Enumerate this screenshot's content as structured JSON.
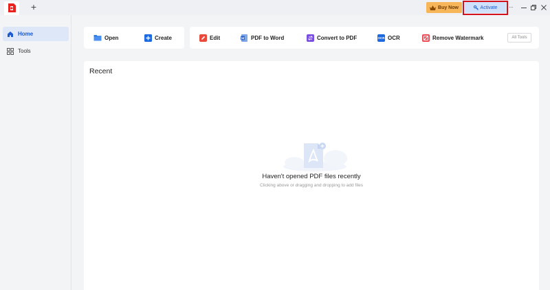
{
  "titlebar": {
    "new_tab": "+",
    "buy_now": "Buy Now",
    "activate": "Activate",
    "more": "···",
    "icons": [
      "app-logo",
      "crown-icon",
      "key-icon",
      "minimize-icon",
      "restore-icon",
      "close-icon"
    ]
  },
  "sidebar": {
    "items": [
      {
        "label": "Home",
        "icon": "home-icon",
        "active": true
      },
      {
        "label": "Tools",
        "icon": "grid-icon",
        "active": false
      }
    ]
  },
  "toolbar": {
    "open": "Open",
    "create": "Create",
    "edit": "Edit",
    "pdf_to_word": "PDF to Word",
    "convert_to_pdf": "Convert to PDF",
    "ocr": "OCR",
    "ocr_badge": "OCR",
    "remove_watermark": "Remove Watermark",
    "all_tools": "All Tools"
  },
  "recent": {
    "title": "Recent",
    "empty_title": "Haven't opened PDF files recently",
    "empty_subtitle": "Clicking above or dragging and dropping to add files"
  },
  "colors": {
    "accent": "#1d5bd1",
    "buy_now_bg": "#f7b65a",
    "activate_bg": "#cfe1fb",
    "highlight": "#d4101c"
  }
}
